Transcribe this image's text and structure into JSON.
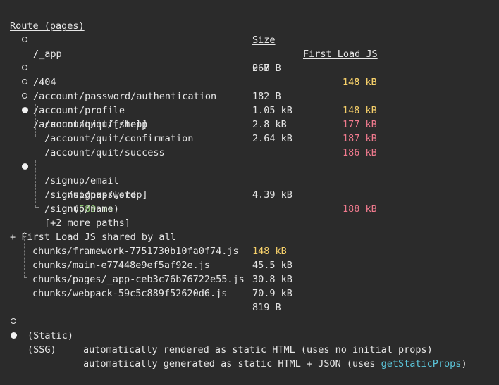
{
  "header": {
    "route": "Route (pages)",
    "size": "Size",
    "first_load": "First Load JS"
  },
  "routes": [
    {
      "marker": "static",
      "path": "/",
      "size": "267 B",
      "first_load": "148 kB",
      "color": "#f6d06a"
    },
    {
      "marker": "none",
      "path": "/_app",
      "size": "0 B",
      "first_load": "148 kB",
      "color": "#f6d06a"
    },
    {
      "marker": "static",
      "path": "/404",
      "size": "182 B",
      "first_load": "148 kB",
      "color": "#f6d06a"
    },
    {
      "marker": "static",
      "path": "/account/password/authentication",
      "size": "1.05 kB",
      "first_load": "177 kB",
      "color": "#f07a8e"
    },
    {
      "marker": "static",
      "path": "/account/profile",
      "size": "2.8 kB",
      "first_load": "187 kB",
      "color": "#f07a8e"
    },
    {
      "marker": "ssg",
      "path": "/account/quit/[step]",
      "size": "2.64 kB",
      "first_load": "186 kB",
      "color": "#f07a8e"
    },
    {
      "marker": "sub",
      "path": "/account/quit/help"
    },
    {
      "marker": "sub",
      "path": "/account/quit/confirmation"
    },
    {
      "marker": "sub",
      "path": "/account/quit/success"
    },
    {
      "marker": "ssg",
      "path": "/signup/[step]",
      "timing": "589 ms",
      "size": "4.39 kB",
      "first_load": "188 kB",
      "color": "#f07a8e"
    },
    {
      "marker": "sub",
      "path": "/signup/email"
    },
    {
      "marker": "sub",
      "path": "/signup/password"
    },
    {
      "marker": "sub",
      "path": "/signup/name"
    },
    {
      "marker": "sub",
      "path": "[+2 more paths]"
    }
  ],
  "shared": {
    "label": "+ First Load JS shared by all",
    "size": "148 kB",
    "chunks": [
      {
        "name": "chunks/framework-7751730b10fa0f74.js",
        "size": "45.5 kB"
      },
      {
        "name": "chunks/main-e77448e9ef5af92e.js",
        "size": "30.8 kB"
      },
      {
        "name": "chunks/pages/_app-ceb3c76b76722e55.js",
        "size": "70.9 kB"
      },
      {
        "name": "chunks/webpack-59c5c889f52620d6.js",
        "size": "819 B"
      }
    ]
  },
  "legend": {
    "static_label": "(Static)",
    "static_desc": "automatically rendered as static HTML (uses no initial props)",
    "ssg_label": "(SSG)",
    "ssg_desc_prefix": "automatically generated as static HTML + JSON (uses ",
    "ssg_fn": "getStaticProps",
    "ssg_desc_suffix": ")"
  },
  "colors": {
    "yellow": "#f6d06a",
    "pink": "#f07a8e",
    "green": "#8cc572",
    "cyan": "#5bc4d8",
    "background": "#2b2b2b"
  }
}
